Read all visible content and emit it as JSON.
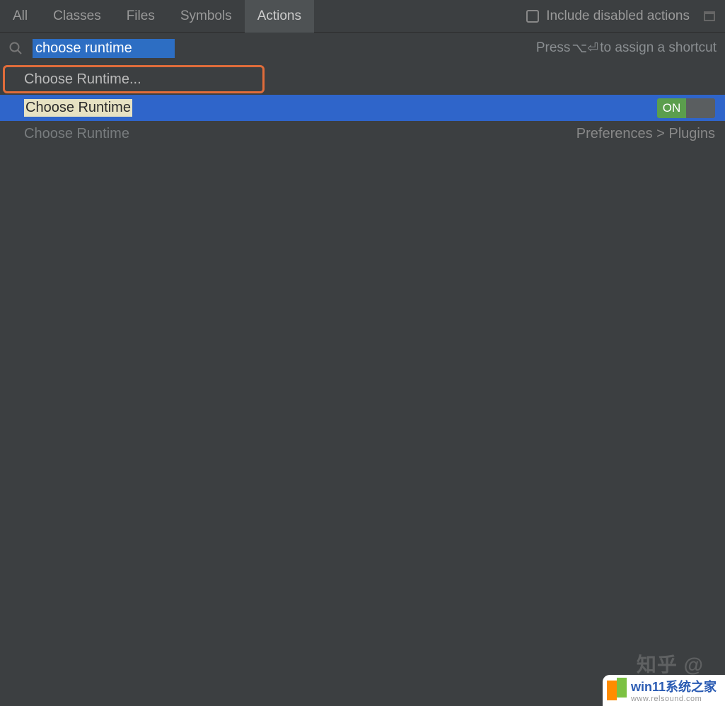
{
  "tabs": {
    "all": "All",
    "classes": "Classes",
    "files": "Files",
    "symbols": "Symbols",
    "actions": "Actions"
  },
  "header": {
    "include_disabled_label": "Include disabled actions"
  },
  "search": {
    "query": "choose runtime",
    "hint_prefix": "Press ",
    "hint_keys": "⌥⏎",
    "hint_suffix": " to assign a shortcut"
  },
  "results": {
    "r1_label": "Choose Runtime...",
    "r2_label": "Choose Runtime",
    "r2_toggle": "ON",
    "r3_label": "Choose Runtime",
    "r3_path": "Preferences > Plugins"
  },
  "watermarks": {
    "zhihu": "知乎 @",
    "brand": "win11系统之家",
    "brand_url": "www.relsound.com"
  }
}
